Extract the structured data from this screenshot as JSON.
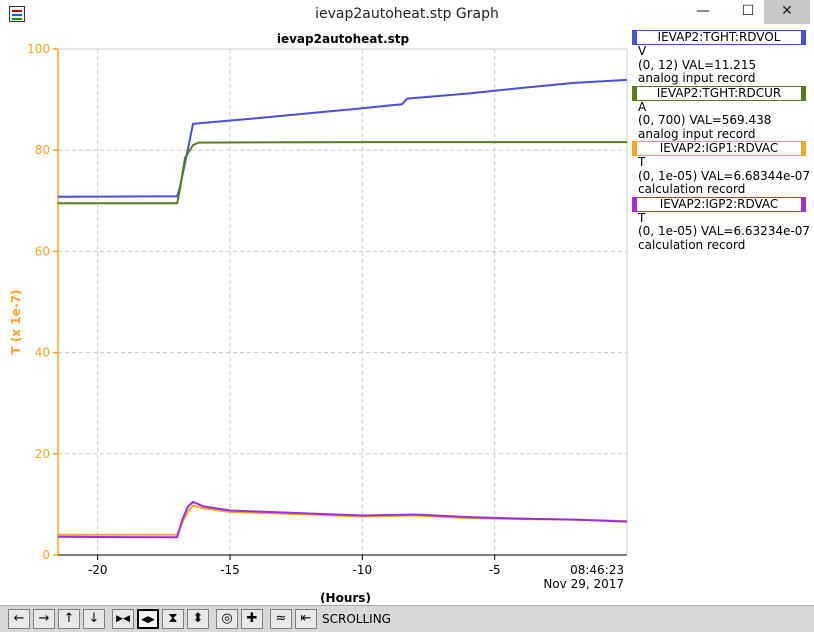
{
  "window": {
    "title": "ievap2autoheat.stp Graph",
    "minimize": "—",
    "maximize": "☐",
    "close": "✕"
  },
  "legend": [
    {
      "name": "IEVAP2:TGHT:RDVOL",
      "unit": "V",
      "info": "(0, 12) VAL=11.215",
      "kind": "analog input record",
      "color": "#4b4fd8"
    },
    {
      "name": "IEVAP2:TGHT:RDCUR",
      "unit": "A",
      "info": "(0, 700) VAL=569.438",
      "kind": "analog input record",
      "color": "#5a7a20"
    },
    {
      "name": "IEVAP2:IGP1:RDVAC",
      "unit": "T",
      "info": "(0, 1e-05) VAL=6.68344e-07",
      "kind": "calculation record",
      "color": "#f5a623"
    },
    {
      "name": "IEVAP2:IGP2:RDVAC",
      "unit": "T",
      "info": "(0, 1e-05) VAL=6.63234e-07",
      "kind": "calculation record",
      "color": "#9b30d9"
    }
  ],
  "toolbar": {
    "buttons": [
      {
        "name": "scroll-left-button",
        "glyph": "←"
      },
      {
        "name": "scroll-right-button",
        "glyph": "→"
      },
      {
        "name": "scroll-up-button",
        "glyph": "↑"
      },
      {
        "name": "scroll-down-button",
        "glyph": "↓"
      },
      {
        "name": "zoom-in-x-button",
        "glyph": "▶◀"
      },
      {
        "name": "zoom-out-x-button",
        "glyph": "◀▶"
      },
      {
        "name": "zoom-in-y-button",
        "glyph": "⧗"
      },
      {
        "name": "zoom-out-y-button",
        "glyph": "⬍"
      },
      {
        "name": "center-button",
        "glyph": "◎"
      },
      {
        "name": "add-button",
        "glyph": "✚"
      },
      {
        "name": "autoscale-button",
        "glyph": "≈"
      },
      {
        "name": "go-to-end-button",
        "glyph": "⇤"
      }
    ],
    "status": "SCROLLING"
  },
  "chart_data": {
    "type": "line",
    "title": "ievap2autoheat.stp",
    "xlabel": "(Hours)",
    "ylabel": "T (x 1e-7)",
    "xlim": [
      -21.5,
      0
    ],
    "ylim": [
      0,
      100
    ],
    "x_ticks": [
      -20,
      -15,
      -10,
      -5
    ],
    "y_ticks": [
      0,
      20,
      40,
      60,
      80,
      100
    ],
    "end_time": "08:46:23",
    "end_date": "Nov 29, 2017",
    "grid": true,
    "axis_color": "#f5a623",
    "series": [
      {
        "name": "IEVAP2:TGHT:RDVOL",
        "color": "#4b4fd8",
        "x": [
          -21.5,
          -17.0,
          -16.9,
          -16.6,
          -16.4,
          -16.0,
          -14.0,
          -12.0,
          -10.0,
          -8.5,
          -8.3,
          -6.0,
          -4.0,
          -2.0,
          0.0
        ],
        "y": [
          70.8,
          70.9,
          72.5,
          80.0,
          85.2,
          85.4,
          86.3,
          87.3,
          88.3,
          89.1,
          90.2,
          91.2,
          92.3,
          93.3,
          93.9
        ]
      },
      {
        "name": "IEVAP2:TGHT:RDCUR",
        "color": "#5a7a20",
        "x": [
          -21.5,
          -17.0,
          -16.9,
          -16.7,
          -16.4,
          -16.2,
          -10.0,
          0.0
        ],
        "y": [
          69.5,
          69.5,
          72.0,
          78.5,
          81.0,
          81.5,
          81.6,
          81.6
        ]
      },
      {
        "name": "IEVAP2:IGP1:RDVAC",
        "color": "#f5a623",
        "x": [
          -21.5,
          -17.0,
          -16.8,
          -16.6,
          -16.4,
          -16.0,
          -15.0,
          -12.0,
          -10.0,
          -8.0,
          -6.0,
          -4.0,
          -2.0,
          0.0
        ],
        "y": [
          4.0,
          4.0,
          6.5,
          8.5,
          9.8,
          9.2,
          8.5,
          8.0,
          7.6,
          7.8,
          7.3,
          7.1,
          7.0,
          6.7
        ]
      },
      {
        "name": "IEVAP2:IGP2:RDVAC",
        "color": "#9b30d9",
        "x": [
          -21.5,
          -17.0,
          -16.8,
          -16.6,
          -16.4,
          -16.0,
          -15.0,
          -12.0,
          -10.0,
          -8.0,
          -6.0,
          -4.0,
          -2.0,
          0.0
        ],
        "y": [
          3.6,
          3.5,
          7.0,
          9.5,
          10.5,
          9.6,
          8.8,
          8.2,
          7.8,
          8.0,
          7.5,
          7.2,
          7.0,
          6.6
        ]
      }
    ]
  }
}
